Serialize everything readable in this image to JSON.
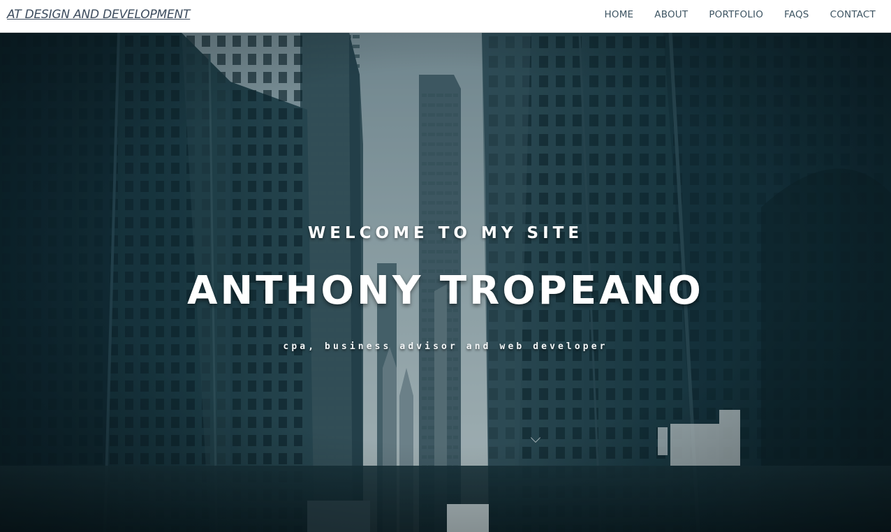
{
  "brand": {
    "name": "AT DESIGN AND DEVELOPMENT"
  },
  "nav": {
    "items": [
      {
        "label": "HOME"
      },
      {
        "label": "ABOUT"
      },
      {
        "label": "PORTFOLIO"
      },
      {
        "label": "FAQS"
      },
      {
        "label": "CONTACT"
      }
    ]
  },
  "hero": {
    "eyebrow": "WELCOME TO MY SITE",
    "title": "ANTHONY TROPEANO",
    "tagline": "cpa, business advisor and web developer"
  },
  "colors": {
    "nav_bg": "#ffffff",
    "nav_text": "#3e5563",
    "hero_text": "#ffffff",
    "hero_tint": "#16323b"
  }
}
